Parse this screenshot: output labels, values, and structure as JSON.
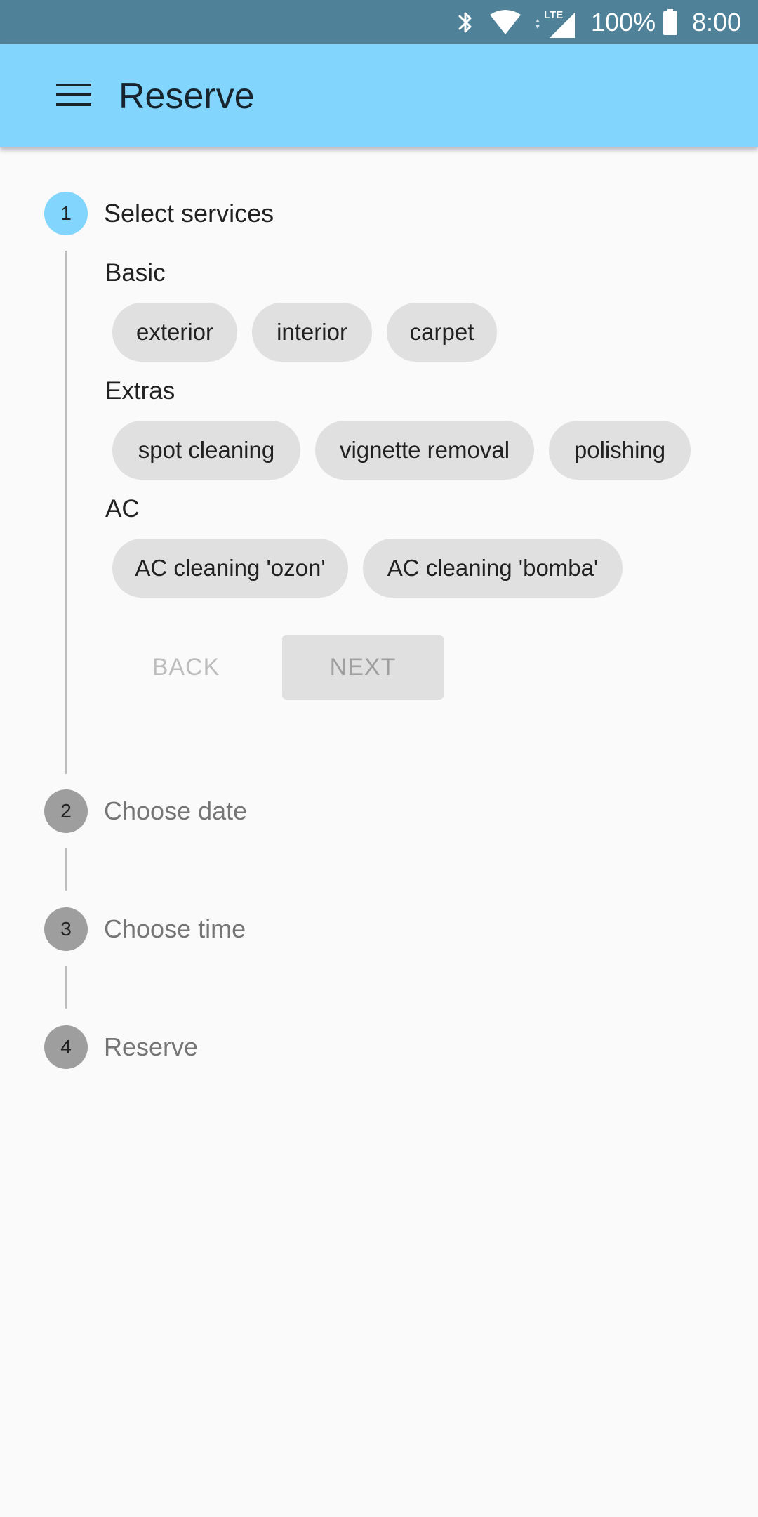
{
  "status_bar": {
    "battery_percent": "100%",
    "time": "8:00",
    "network_label": "LTE",
    "icons": [
      "bluetooth-icon",
      "wifi-icon",
      "signal-icon",
      "battery-icon"
    ]
  },
  "app_bar": {
    "title": "Reserve",
    "menu_icon": "menu-icon",
    "background": "#82d5fd"
  },
  "stepper": {
    "steps": [
      {
        "number": "1",
        "title": "Select services",
        "state": "active"
      },
      {
        "number": "2",
        "title": "Choose date",
        "state": "inactive"
      },
      {
        "number": "3",
        "title": "Choose time",
        "state": "inactive"
      },
      {
        "number": "4",
        "title": "Reserve",
        "state": "inactive"
      }
    ],
    "groups": [
      {
        "label": "Basic",
        "chips": [
          "exterior",
          "interior",
          "carpet"
        ]
      },
      {
        "label": "Extras",
        "chips": [
          "spot cleaning",
          "vignette removal",
          "polishing"
        ]
      },
      {
        "label": "AC",
        "chips": [
          "AC cleaning 'ozon'",
          "AC cleaning 'bomba'"
        ]
      }
    ],
    "buttons": {
      "back": "BACK",
      "next": "NEXT"
    }
  },
  "colors": {
    "accent": "#82d5fd",
    "status_bar": "#4f8299",
    "inactive_step": "#9e9e9e",
    "chip": "#e0e0e0"
  }
}
